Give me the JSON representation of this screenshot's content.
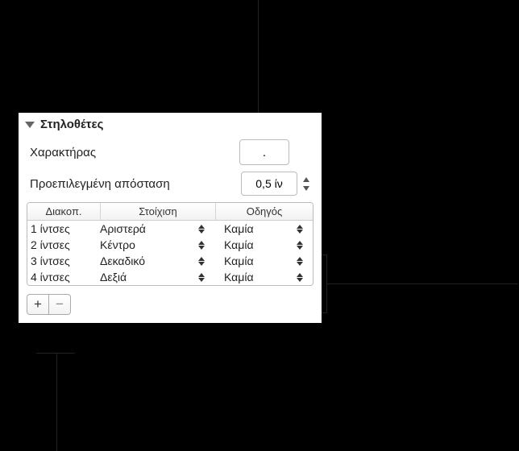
{
  "section": {
    "title": "Στηλοθέτες"
  },
  "character": {
    "label": "Χαρακτήρας",
    "value": "."
  },
  "spacing": {
    "label": "Προεπιλεγμένη απόσταση",
    "value": "0,5 ίν"
  },
  "table": {
    "headers": {
      "stop": "Διακοπ.",
      "align": "Στοίχιση",
      "leader": "Οδηγός"
    },
    "rows": [
      {
        "stop": "1 ίντσες",
        "align": "Αριστερά",
        "leader": "Καμία"
      },
      {
        "stop": "2 ίντσες",
        "align": "Κέντρο",
        "leader": "Καμία"
      },
      {
        "stop": "3 ίντσες",
        "align": "Δεκαδικό",
        "leader": "Καμία"
      },
      {
        "stop": "4 ίντσες",
        "align": "Δεξιά",
        "leader": "Καμία"
      }
    ]
  },
  "buttons": {
    "add": "+",
    "remove": "−"
  }
}
